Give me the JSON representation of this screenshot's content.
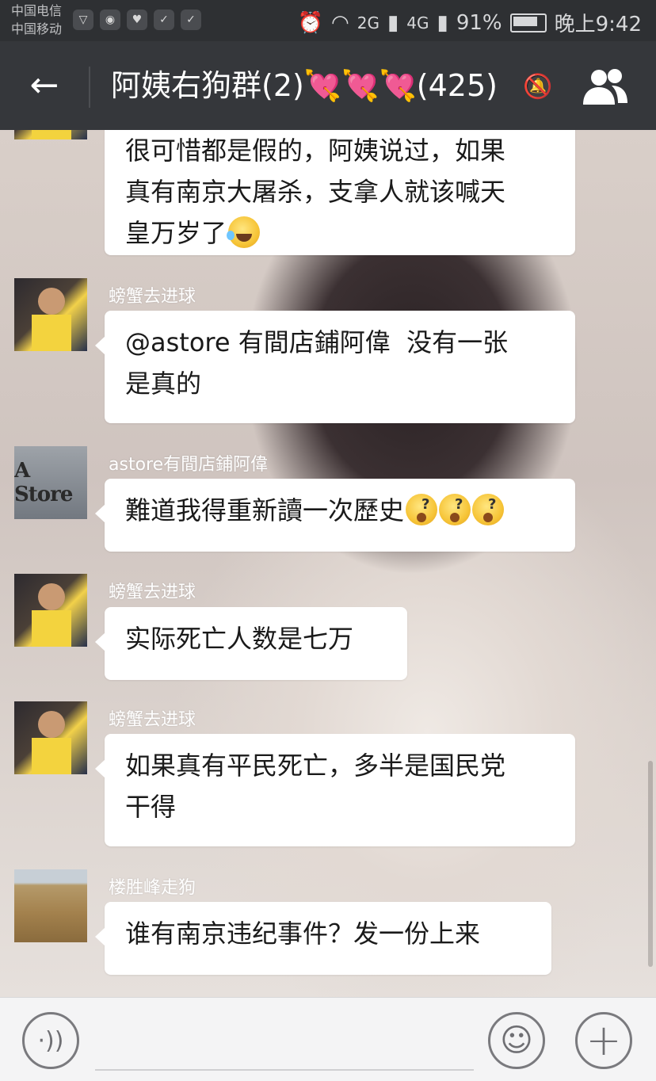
{
  "status_bar": {
    "carrier1": "中国电信",
    "carrier2": "中国移动",
    "network1": "2G",
    "network2": "4G",
    "battery": "91%",
    "time": "晚上9:42",
    "icons": [
      "shield-icon",
      "weibo-icon",
      "heart-shield-icon",
      "alarm-icon",
      "wifi-icon",
      "signal-icon",
      "battery-icon"
    ]
  },
  "header": {
    "back_glyph": "←",
    "title_prefix": "阿姨右狗群(2)",
    "title_hearts": "💘💘💘",
    "title_count": "(425)",
    "mute_glyph": "🔕"
  },
  "messages": [
    {
      "sender": "",
      "text": "很可惜都是假的，阿姨说过，如果\n真有南京大屠杀，支拿人就该喊天\n皇万岁了",
      "emoji": "laugh-emoji"
    },
    {
      "sender": "螃蟹去进球",
      "text": "@astore 有間店鋪阿偉  没有一张\n是真的"
    },
    {
      "sender": "astore有間店鋪阿偉",
      "text": "難道我得重新讀一次歷史",
      "avatar_text": "A Store",
      "emoji": "dizzy-emoji"
    },
    {
      "sender": "螃蟹去进球",
      "text": "实际死亡人数是七万"
    },
    {
      "sender": "螃蟹去进球",
      "text": "如果真有平民死亡，多半是国民党\n干得"
    },
    {
      "sender": "楼胜峰走狗",
      "text": "谁有南京违纪事件？发一份上来"
    }
  ],
  "input_bar": {
    "voice_glyph": "·))",
    "emoji_glyph": "☺",
    "plus_glyph": "+"
  },
  "colors": {
    "header_bg": "#35373b",
    "status_bg": "#2e3033",
    "bubble_bg": "#ffffff",
    "input_bg": "#f4f4f5"
  }
}
